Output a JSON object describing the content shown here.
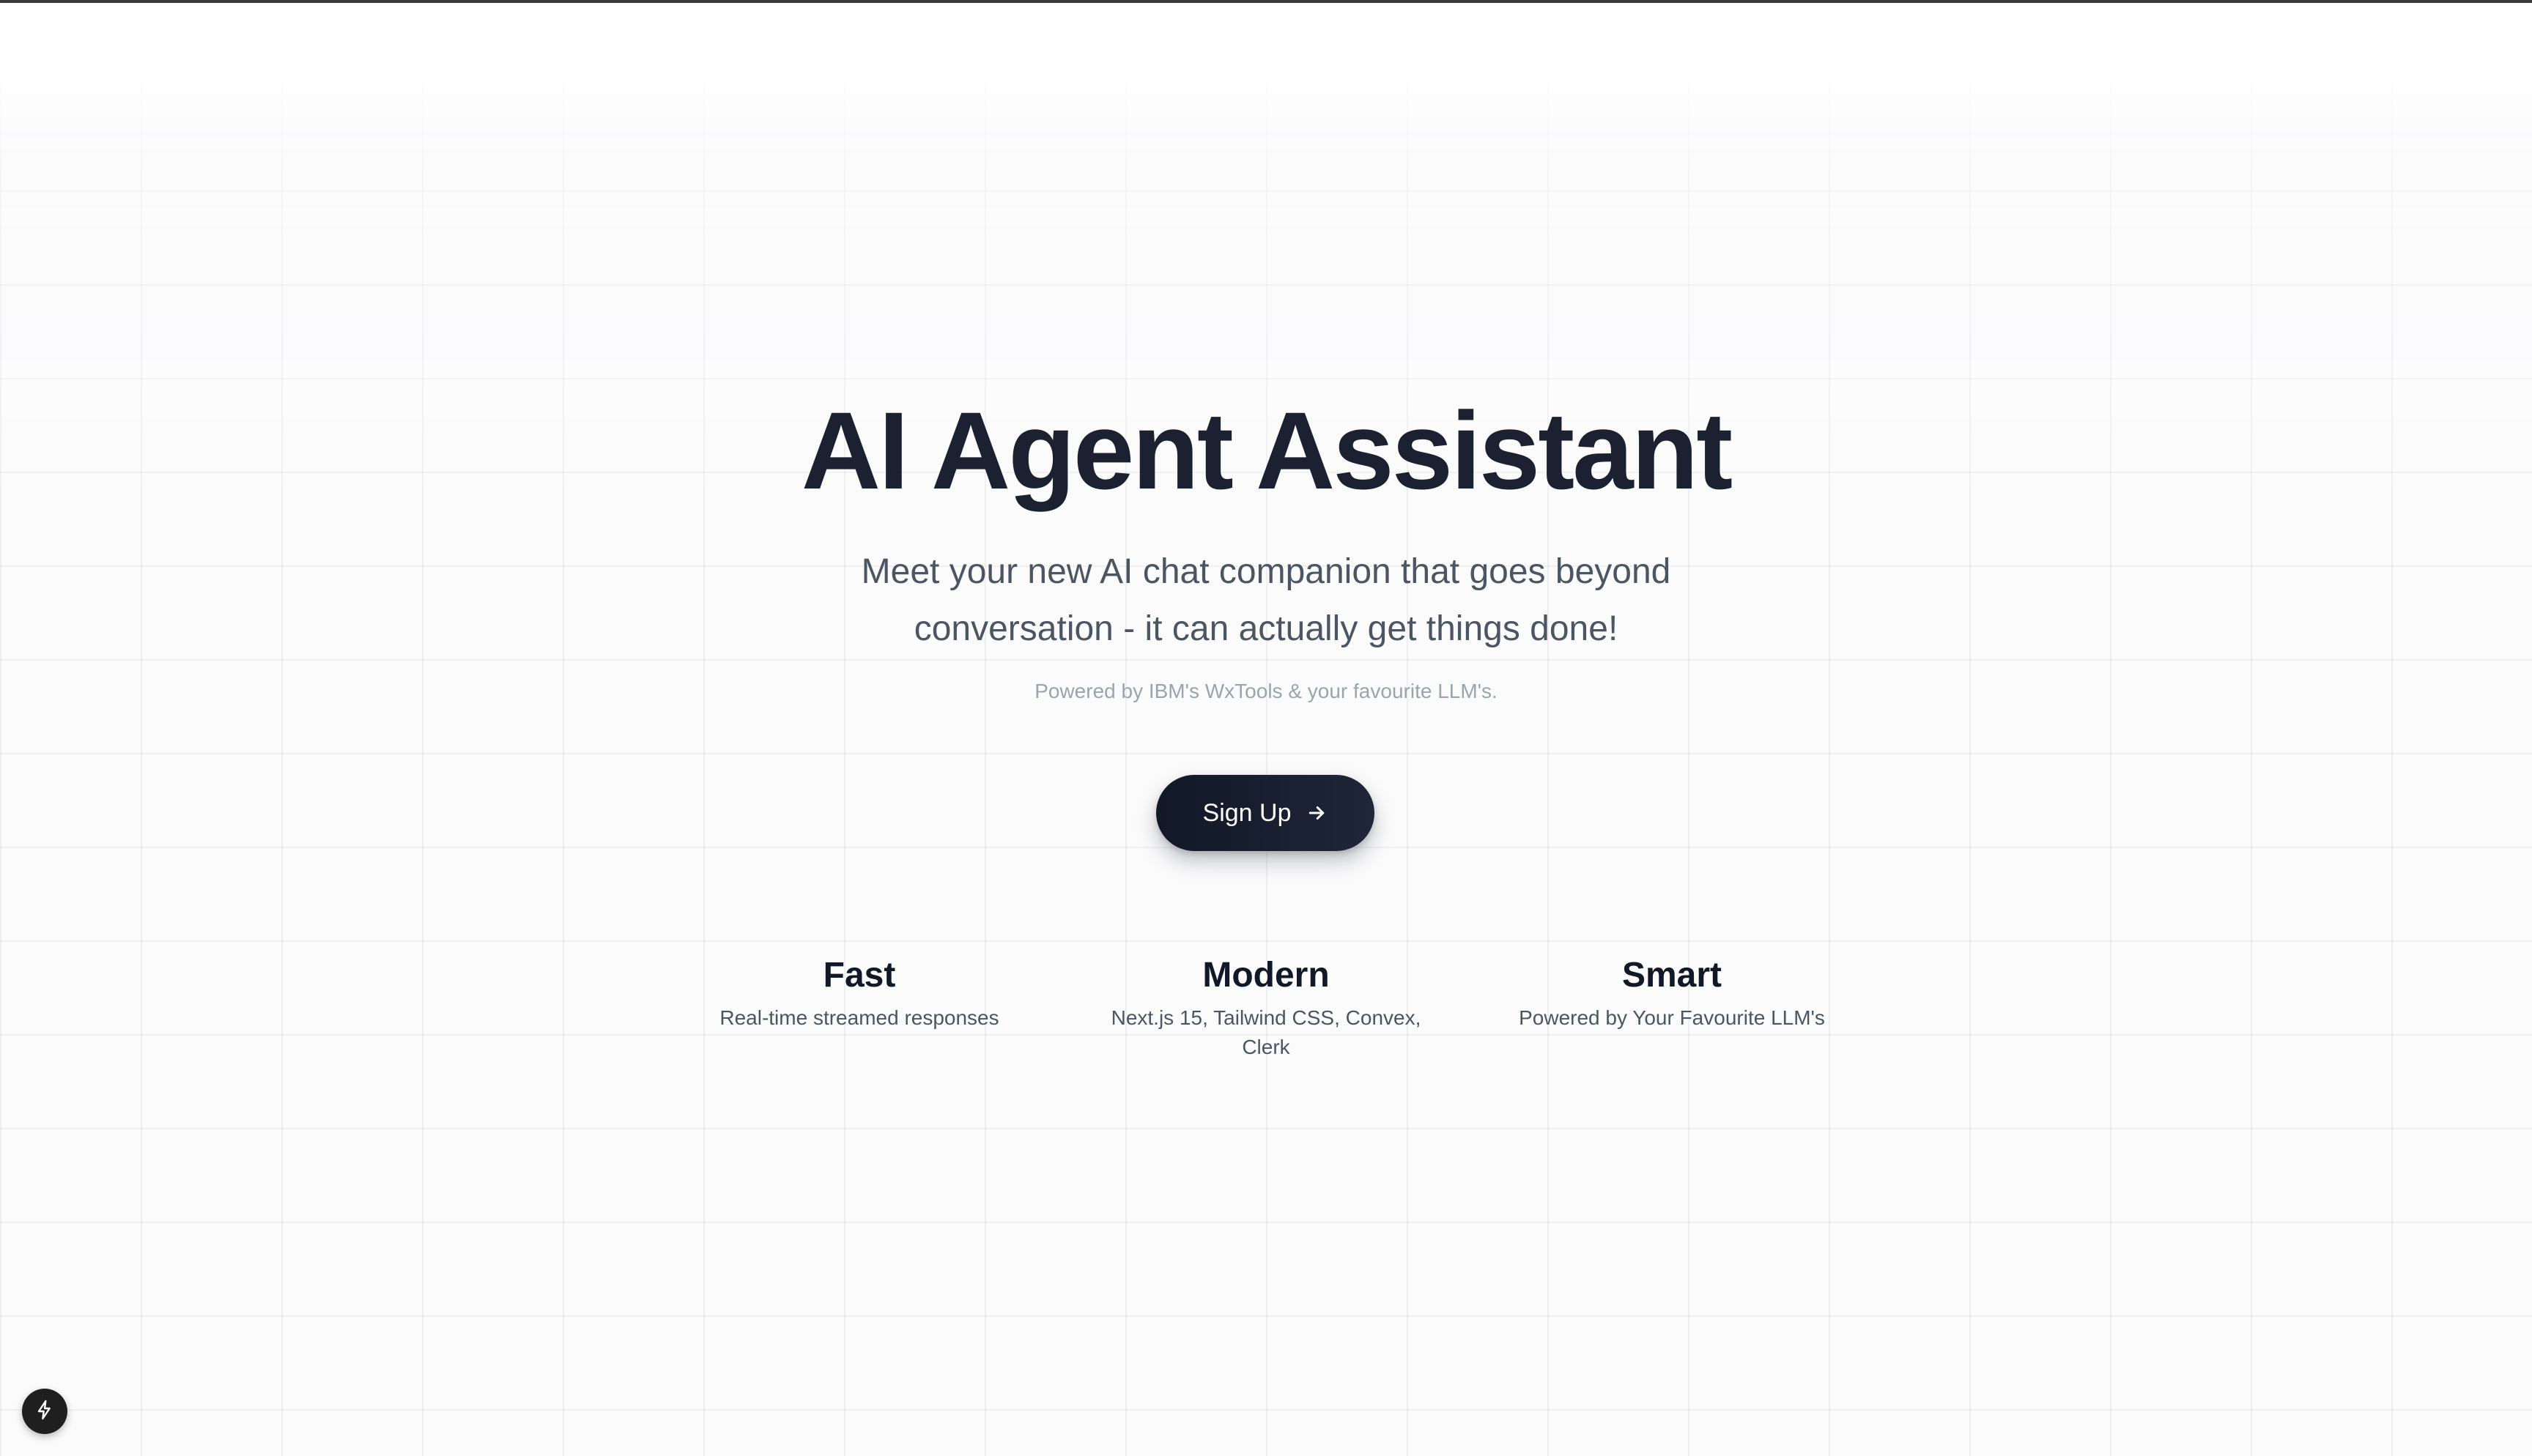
{
  "hero": {
    "title": "AI Agent Assistant",
    "subtitle": "Meet your new AI chat companion that goes beyond conversation - it can actually get things done!",
    "note": "Powered by IBM's WxTools & your favourite LLM's."
  },
  "cta": {
    "label": "Sign Up",
    "icon": "arrow-right-icon"
  },
  "features": [
    {
      "title": "Fast",
      "description": "Real-time streamed responses"
    },
    {
      "title": "Modern",
      "description": "Next.js 15, Tailwind CSS, Convex, Clerk"
    },
    {
      "title": "Smart",
      "description": "Powered by Your Favourite LLM's"
    }
  ],
  "dev_badge": {
    "icon": "lightning-bolt-icon"
  },
  "colors": {
    "text_primary": "#1b2130",
    "text_secondary": "#4b5563",
    "text_muted": "#9ca3af",
    "button_bg": "#111827",
    "button_text": "#ffffff",
    "background": "#fbfbfc"
  }
}
